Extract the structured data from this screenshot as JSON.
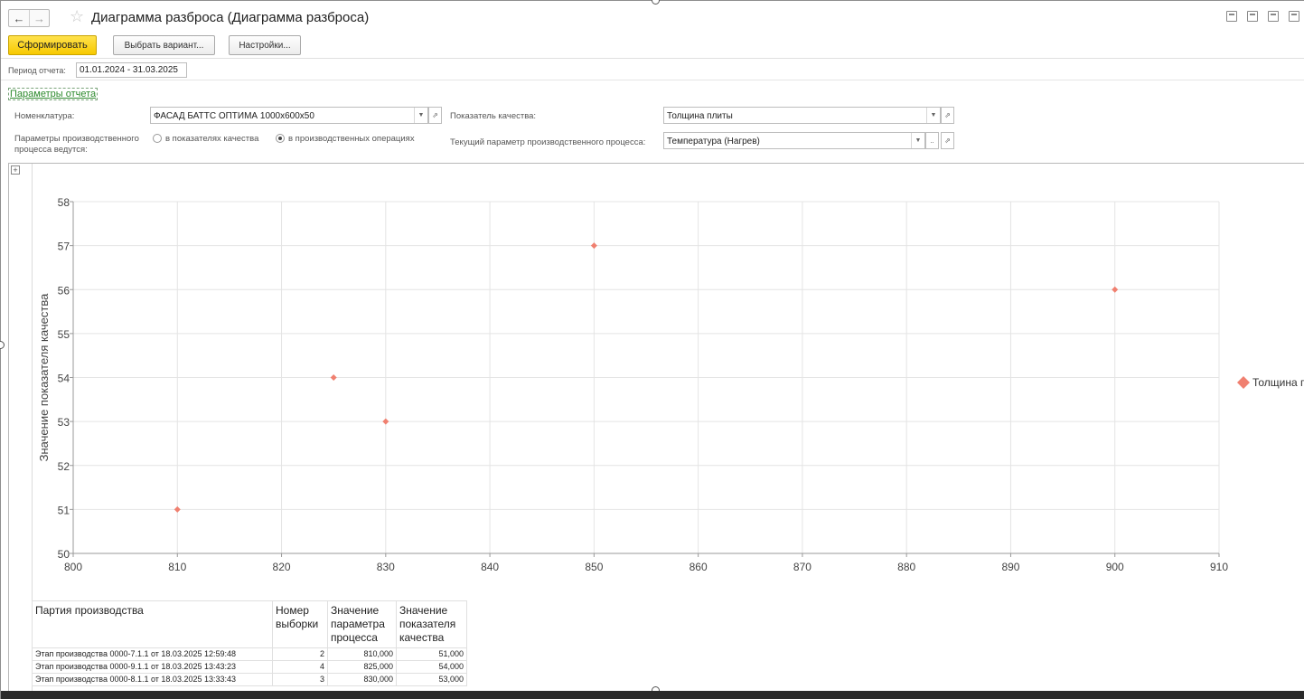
{
  "window": {
    "title": "Диаграмма разброса (Диаграмма разброса)"
  },
  "icons": {
    "back": "arrow-left",
    "forward": "arrow-right",
    "favorite": "star-outline",
    "save": "save-icon",
    "print": "print-icon",
    "preview": "preview-icon",
    "link": "link-icon"
  },
  "toolbar": {
    "generate_label": "Сформировать",
    "choose_variant_label": "Выбрать вариант...",
    "settings_label": "Настройки..."
  },
  "period": {
    "label": "Период отчета:",
    "value": "01.01.2024 - 31.03.2025"
  },
  "params": {
    "link_label": "Параметры отчета",
    "nomenclature_label": "Номенклатура:",
    "nomenclature_value": "ФАСАД БАТТС ОПТИМА 1000x600x50",
    "quality_label": "Показатель качества:",
    "quality_value": "Толщина плиты",
    "process_params_label_1": "Параметры производственного",
    "process_params_label_2": "процесса ведутся:",
    "radio_quality": "в показателях качества",
    "radio_operations": "в производственных операциях",
    "radio_selected": "operations",
    "current_param_label": "Текущий параметр производственного процесса:",
    "current_param_value": "Температура (Нагрев)"
  },
  "chart_data": {
    "type": "scatter",
    "ylabel": "Значение показателя качества",
    "xlim": [
      800,
      910
    ],
    "ylim": [
      50,
      58
    ],
    "x_ticks": [
      "800",
      "810",
      "820",
      "830",
      "840",
      "850",
      "860",
      "870",
      "880",
      "890",
      "900",
      "910"
    ],
    "y_ticks": [
      "50",
      "51",
      "52",
      "53",
      "54",
      "55",
      "56",
      "57",
      "58"
    ],
    "grid": true,
    "legend_position": "right",
    "series": [
      {
        "name": "Толщина плиты",
        "legend_text": "Толщина п",
        "color": "#f08070",
        "marker": "diamond",
        "points": [
          [
            810,
            51
          ],
          [
            825,
            54
          ],
          [
            830,
            53
          ],
          [
            850,
            57
          ],
          [
            900,
            56
          ]
        ]
      }
    ]
  },
  "table": {
    "headers": {
      "batch": "Партия производства",
      "sample_1": "Номер",
      "sample_2": "выборки",
      "param_1": "Значение",
      "param_2": "параметра",
      "param_3": "процесса",
      "quality_1": "Значение",
      "quality_2": "показателя",
      "quality_3": "качества"
    },
    "rows": [
      {
        "batch": "Этап производства 0000-7.1.1 от 18.03.2025 12:59:48",
        "sample": "2",
        "param": "810,000",
        "quality": "51,000"
      },
      {
        "batch": "Этап производства 0000-9.1.1 от 18.03.2025 13:43:23",
        "sample": "4",
        "param": "825,000",
        "quality": "54,000"
      },
      {
        "batch": "Этап производства 0000-8.1.1 от 18.03.2025 13:33:43",
        "sample": "3",
        "param": "830,000",
        "quality": "53,000"
      }
    ]
  }
}
